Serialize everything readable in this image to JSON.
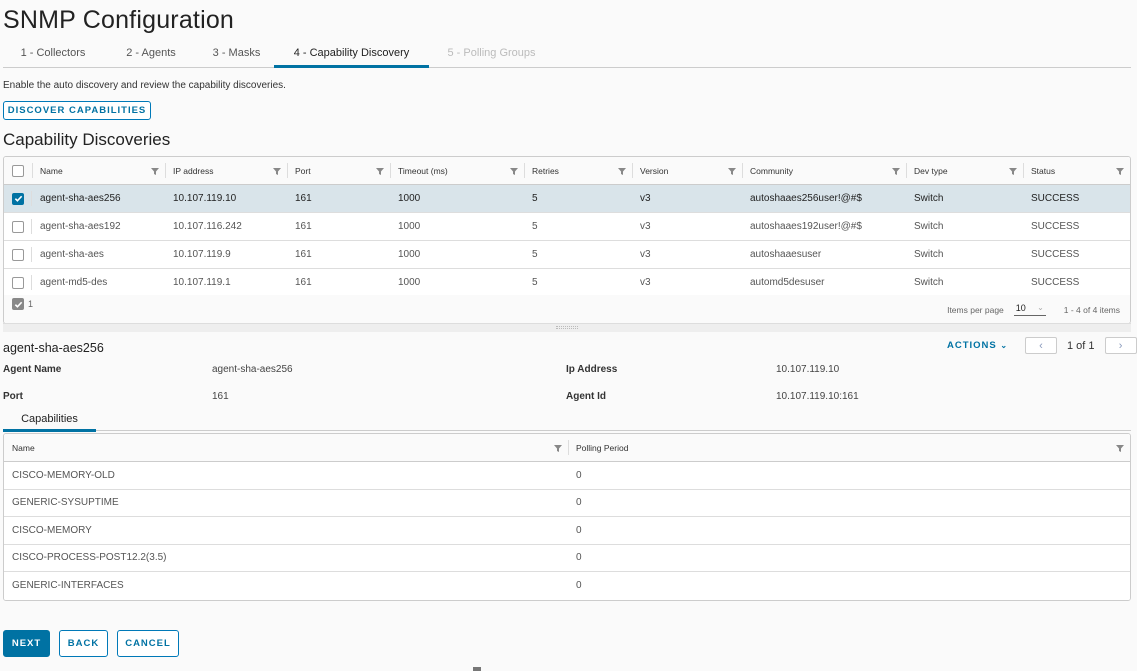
{
  "page": {
    "title": "SNMP Configuration",
    "intro": "Enable the auto discovery and review the capability discoveries."
  },
  "steps": [
    {
      "label": "1 - Collectors",
      "state": "done"
    },
    {
      "label": "2 - Agents",
      "state": "done"
    },
    {
      "label": "3 - Masks",
      "state": "done"
    },
    {
      "label": "4 - Capability Discovery",
      "state": "active"
    },
    {
      "label": "5 - Polling Groups",
      "state": "disabled"
    }
  ],
  "discover_button": "DISCOVER CAPABILITIES",
  "discoveries": {
    "title": "Capability Discoveries",
    "columns": [
      "Name",
      "IP address",
      "Port",
      "Timeout (ms)",
      "Retries",
      "Version",
      "Community",
      "Dev type",
      "Status"
    ],
    "rows": [
      {
        "selected": true,
        "name": "agent-sha-aes256",
        "ip": "10.107.119.10",
        "port": "161",
        "timeout": "1000",
        "retries": "5",
        "version": "v3",
        "community": "autoshaaes256user!@#$",
        "devtype": "Switch",
        "status": "SUCCESS"
      },
      {
        "selected": false,
        "name": "agent-sha-aes192",
        "ip": "10.107.116.242",
        "port": "161",
        "timeout": "1000",
        "retries": "5",
        "version": "v3",
        "community": "autoshaaes192user!@#$",
        "devtype": "Switch",
        "status": "SUCCESS"
      },
      {
        "selected": false,
        "name": "agent-sha-aes",
        "ip": "10.107.119.9",
        "port": "161",
        "timeout": "1000",
        "retries": "5",
        "version": "v3",
        "community": "autoshaaesuser",
        "devtype": "Switch",
        "status": "SUCCESS"
      },
      {
        "selected": false,
        "name": "agent-md5-des",
        "ip": "10.107.119.1",
        "port": "161",
        "timeout": "1000",
        "retries": "5",
        "version": "v3",
        "community": "automd5desuser",
        "devtype": "Switch",
        "status": "SUCCESS"
      }
    ],
    "footer": {
      "selected_count": "1",
      "items_per_page_label": "Items per page",
      "items_per_page": "10",
      "range": "1 - 4 of 4 items"
    }
  },
  "detail": {
    "title": "agent-sha-aes256",
    "actions_label": "ACTIONS",
    "pager_text": "1 of 1",
    "fields": {
      "agent_name_label": "Agent Name",
      "agent_name": "agent-sha-aes256",
      "ip_label": "Ip Address",
      "ip": "10.107.119.10",
      "port_label": "Port",
      "port": "161",
      "agent_id_label": "Agent Id",
      "agent_id": "10.107.119.10:161"
    },
    "tab": "Capabilities",
    "capabilities": {
      "columns": [
        "Name",
        "Polling Period"
      ],
      "rows": [
        {
          "name": "CISCO-MEMORY-OLD",
          "period": "0"
        },
        {
          "name": "GENERIC-SYSUPTIME",
          "period": "0"
        },
        {
          "name": "CISCO-MEMORY",
          "period": "0"
        },
        {
          "name": "CISCO-PROCESS-POST12.2(3.5)",
          "period": "0"
        },
        {
          "name": "GENERIC-INTERFACES",
          "period": "0"
        }
      ]
    }
  },
  "footer_buttons": {
    "next": "NEXT",
    "back": "BACK",
    "cancel": "CANCEL"
  },
  "colors": {
    "accent": "#0072a3",
    "selected_row": "#d9e4ea"
  }
}
